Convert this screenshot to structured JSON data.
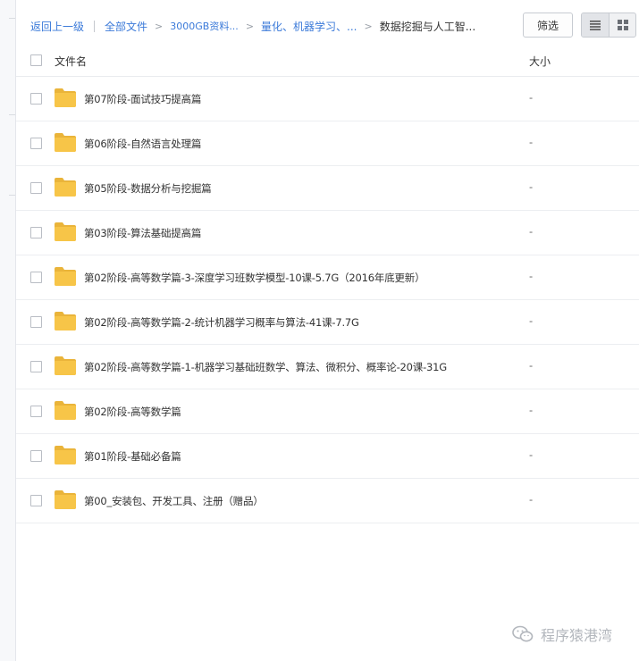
{
  "breadcrumb": {
    "back": "返回上一级",
    "all_files": "全部文件",
    "level1": "3000GB资料...",
    "level2": "量化、机器学习、...",
    "current": "数据挖掘与人工智..."
  },
  "toolbar": {
    "filter_label": "筛选"
  },
  "table": {
    "col_name": "文件名",
    "col_size": "大小",
    "rows": [
      {
        "name": "第07阶段-面试技巧提高篇",
        "size": "-"
      },
      {
        "name": "第06阶段-自然语言处理篇",
        "size": "-"
      },
      {
        "name": "第05阶段-数据分析与挖掘篇",
        "size": "-"
      },
      {
        "name": "第03阶段-算法基础提高篇",
        "size": "-"
      },
      {
        "name": "第02阶段-高等数学篇-3-深度学习班数学模型-10课-5.7G（2016年底更新）",
        "size": "-"
      },
      {
        "name": "第02阶段-高等数学篇-2-统计机器学习概率与算法-41课-7.7G",
        "size": "-"
      },
      {
        "name": "第02阶段-高等数学篇-1-机器学习基础班数学、算法、微积分、概率论-20课-31G",
        "size": "-"
      },
      {
        "name": "第02阶段-高等数学篇",
        "size": "-"
      },
      {
        "name": "第01阶段-基础必备篇",
        "size": "-"
      },
      {
        "name": "第00_安装包、开发工具、注册（赠品）",
        "size": "-"
      }
    ]
  },
  "watermark": {
    "text": "程序猿港湾",
    "icon": "wechat-icon"
  },
  "colors": {
    "link": "#3b7ad9",
    "folder": "#f7c548",
    "folder_dark": "#eab43a"
  }
}
